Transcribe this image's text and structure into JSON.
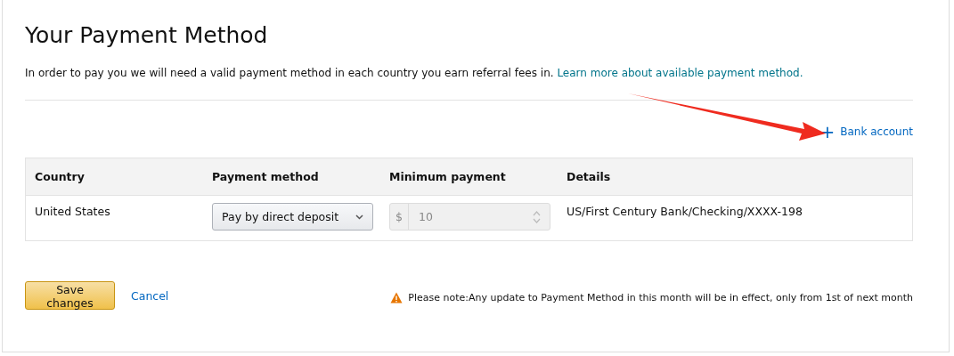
{
  "title": "Your Payment Method",
  "intro": {
    "text": "In order to pay you we will need a valid payment method in each country you earn referral fees in.",
    "link": "Learn more about available payment method."
  },
  "add_button": {
    "icon": "+",
    "label": "Bank account"
  },
  "table": {
    "columns": [
      "Country",
      "Payment method",
      "Minimum payment",
      "Details"
    ],
    "rows": [
      {
        "country": "United States",
        "payment_method": "Pay by direct deposit",
        "currency": "$",
        "minimum_payment": "10",
        "details": "US/First Century Bank/Checking/XXXX-198"
      }
    ]
  },
  "buttons": {
    "save": "Save changes",
    "cancel": "Cancel"
  },
  "note": "Please note:Any update to Payment Method in this month will be in effect, only from 1st of next month"
}
